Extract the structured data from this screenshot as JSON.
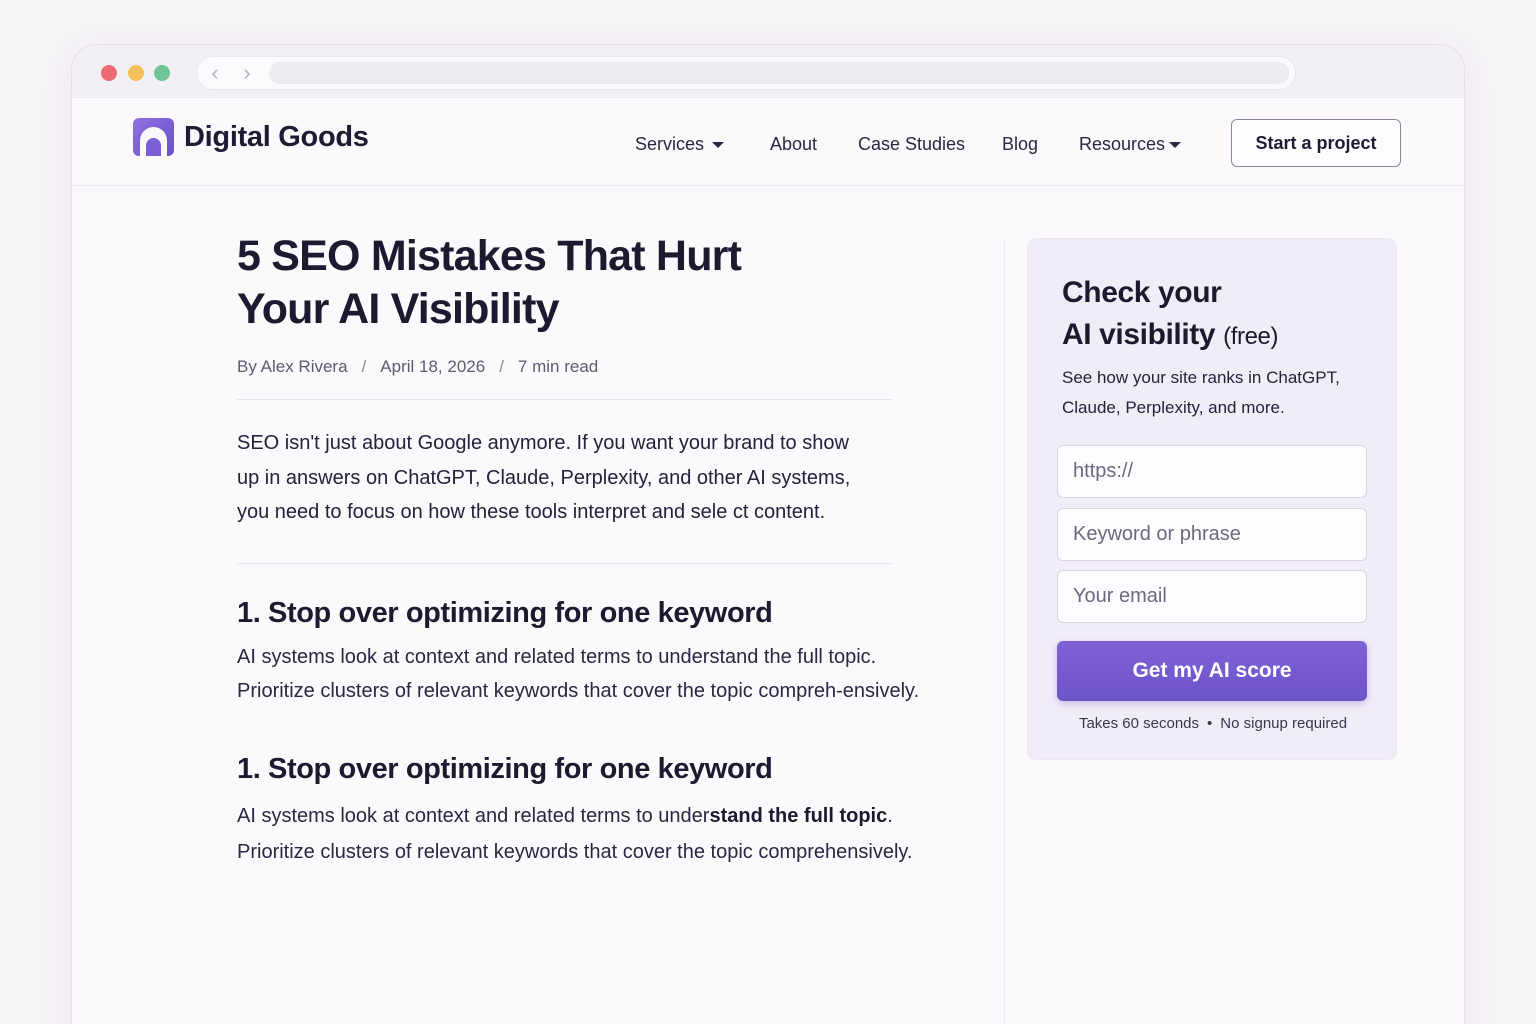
{
  "brand": {
    "name": "Digital Goods",
    "accent": "#7059cf"
  },
  "nav": {
    "items": [
      "Services",
      "About",
      "Case Studies",
      "Blog",
      "Resources"
    ],
    "cta": "Start a project"
  },
  "article": {
    "title": "5 SEO Mistakes That Hurt Your AI Visibility",
    "author": "By Alex Rivera",
    "separator": "/",
    "date": "April 18, 2026",
    "read_time": "7 min read",
    "intro": "SEO isn't just about Google anymore. If you want your brand to show up in answers on ChatGPT, Claude, Perplexity, and other AI systems, you need to focus on how these tools interpret and sele ct content.",
    "sections": [
      {
        "heading": "1. Stop over optimizing for one keyword",
        "body": "AI systems look at context and related terms to understand the full topic. Prioritize clusters of relevant keywords that cover the topic compreh-ensively."
      },
      {
        "heading": "1. Stop over optimizing for one keyword",
        "body_lead": "AI systems look at context and related terms to under",
        "body_bold": "stand the full topic",
        "body_end": ". Prioritize clusters of relevant keywords that cover the topic comprehensively."
      }
    ]
  },
  "widget": {
    "title_line1": "Check your",
    "title_line2": "AI visibility",
    "title_suffix": "(free)",
    "description": "See how your site ranks in ChatGPT, Claude, Perplexity, and more.",
    "url_placeholder": "https://",
    "keyword_placeholder": "Keyword or phrase",
    "email_placeholder": "Your email",
    "button": "Get my AI score",
    "note_left": "Takes 60 seconds",
    "note_bullet": "•",
    "note_right": "No signup required"
  }
}
